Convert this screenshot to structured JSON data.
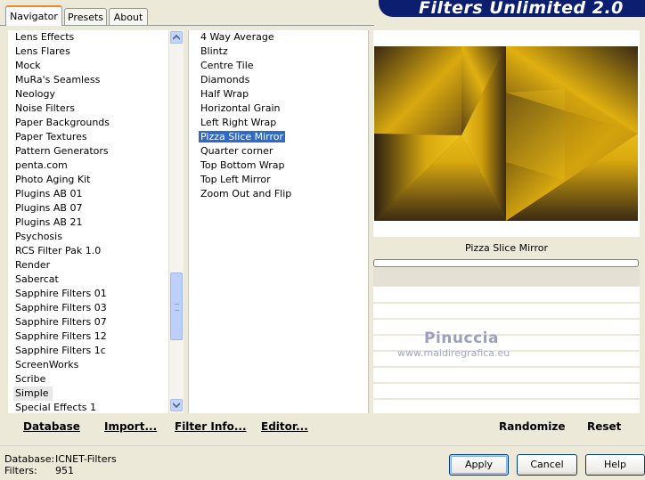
{
  "header": {
    "title": "Filters Unlimited 2.0"
  },
  "tabs": [
    {
      "label": "Navigator",
      "active": true
    },
    {
      "label": "Presets",
      "active": false
    },
    {
      "label": "About",
      "active": false
    }
  ],
  "categories": {
    "items": [
      "Lens Effects",
      "Lens Flares",
      "Mock",
      "MuRa's Seamless",
      "Neology",
      "Noise Filters",
      "Paper Backgrounds",
      "Paper Textures",
      "Pattern Generators",
      "penta.com",
      "Photo Aging Kit",
      "Plugins AB 01",
      "Plugins AB 07",
      "Plugins AB 21",
      "Psychosis",
      "RCS Filter Pak 1.0",
      "Render",
      "Sabercat",
      "Sapphire Filters 01",
      "Sapphire Filters 03",
      "Sapphire Filters 07",
      "Sapphire Filters 12",
      "Sapphire Filters 1c",
      "ScreenWorks",
      "Scribe",
      "Simple",
      "Special Effects 1"
    ],
    "selected": "Simple"
  },
  "filters": {
    "items": [
      "4 Way Average",
      "Blintz",
      "Centre Tile",
      "Diamonds",
      "Half Wrap",
      "Horizontal Grain",
      "Left Right Wrap",
      "Pizza Slice Mirror",
      "Quarter corner",
      "Top Bottom Wrap",
      "Top Left Mirror",
      "Zoom Out and Flip"
    ],
    "selected": "Pizza Slice Mirror"
  },
  "preview": {
    "filter_name": "Pizza Slice Mirror",
    "progress": 0
  },
  "watermark": {
    "name": "Pinuccia",
    "site": "www.maidiregrafica.eu"
  },
  "left_buttons": {
    "database": "Database",
    "import": "Import...",
    "filter_info": "Filter Info...",
    "editor": "Editor..."
  },
  "right_buttons": {
    "randomize": "Randomize",
    "reset": "Reset"
  },
  "status": {
    "database_label": "Database:",
    "database_value": "ICNET-Filters",
    "filters_label": "Filters:",
    "filters_value": "951"
  },
  "dialog_buttons": {
    "apply": "Apply",
    "cancel": "Cancel",
    "help": "Help"
  },
  "colors": {
    "banner": "#0c1e70",
    "selection": "#316ac5",
    "preview_gold": "#d9a90f",
    "preview_dark": "#3a2a12"
  },
  "icons": {
    "scroll_up": "chevron-up-icon",
    "scroll_down": "chevron-down-icon"
  }
}
